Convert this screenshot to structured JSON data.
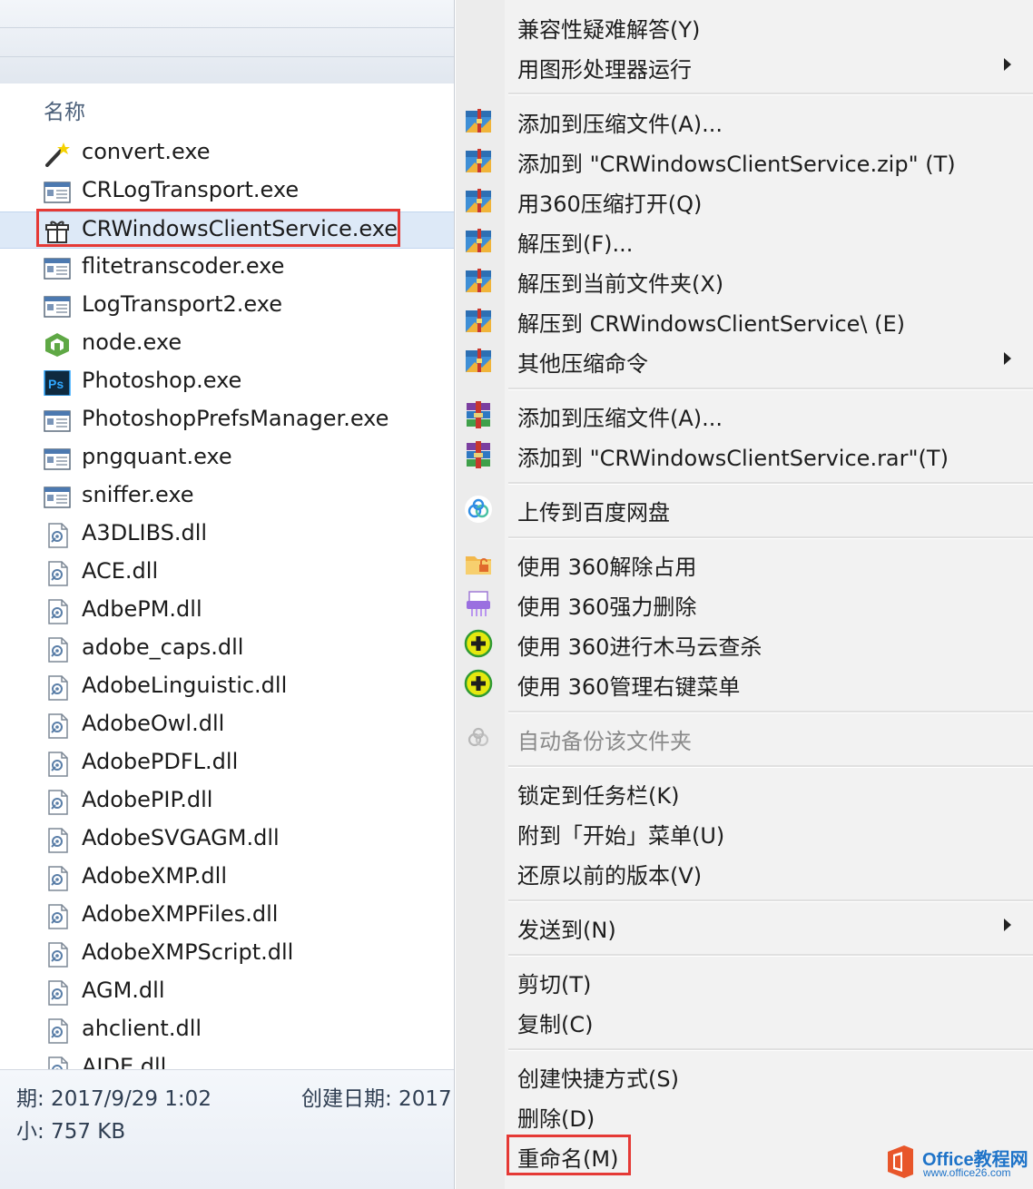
{
  "explorer": {
    "column_header": "名称",
    "files": [
      {
        "name": "convert.exe",
        "icon": "magic-wand-icon"
      },
      {
        "name": "CRLogTransport.exe",
        "icon": "exe-window-icon"
      },
      {
        "name": "CRWindowsClientService.exe",
        "icon": "gift-box-icon",
        "selected": true
      },
      {
        "name": "flitetranscoder.exe",
        "icon": "exe-window-icon"
      },
      {
        "name": "LogTransport2.exe",
        "icon": "exe-window-icon"
      },
      {
        "name": "node.exe",
        "icon": "node-icon"
      },
      {
        "name": "Photoshop.exe",
        "icon": "photoshop-icon"
      },
      {
        "name": "PhotoshopPrefsManager.exe",
        "icon": "exe-window-icon"
      },
      {
        "name": "pngquant.exe",
        "icon": "exe-window-icon"
      },
      {
        "name": "sniffer.exe",
        "icon": "exe-window-icon"
      },
      {
        "name": "A3DLIBS.dll",
        "icon": "dll-icon"
      },
      {
        "name": "ACE.dll",
        "icon": "dll-icon"
      },
      {
        "name": "AdbePM.dll",
        "icon": "dll-icon"
      },
      {
        "name": "adobe_caps.dll",
        "icon": "dll-icon"
      },
      {
        "name": "AdobeLinguistic.dll",
        "icon": "dll-icon"
      },
      {
        "name": "AdobeOwl.dll",
        "icon": "dll-icon"
      },
      {
        "name": "AdobePDFL.dll",
        "icon": "dll-icon"
      },
      {
        "name": "AdobePIP.dll",
        "icon": "dll-icon"
      },
      {
        "name": "AdobeSVGAGM.dll",
        "icon": "dll-icon"
      },
      {
        "name": "AdobeXMP.dll",
        "icon": "dll-icon"
      },
      {
        "name": "AdobeXMPFiles.dll",
        "icon": "dll-icon"
      },
      {
        "name": "AdobeXMPScript.dll",
        "icon": "dll-icon"
      },
      {
        "name": "AGM.dll",
        "icon": "dll-icon"
      },
      {
        "name": "ahclient.dll",
        "icon": "dll-icon"
      },
      {
        "name": "AIDE.dll",
        "icon": "dll-icon"
      }
    ],
    "status": {
      "modified": "期: 2017/9/29 1:02",
      "created": "创建日期: 2017",
      "size": "小: 757 KB"
    }
  },
  "context_menu": {
    "items": [
      {
        "label": "兼容性疑难解答(Y)",
        "icon": ""
      },
      {
        "label": "用图形处理器运行",
        "icon": "",
        "submenu": true
      },
      {
        "sep": true
      },
      {
        "label": "添加到压缩文件(A)...",
        "icon": "zip-archive-icon"
      },
      {
        "label": "添加到 \"CRWindowsClientService.zip\" (T)",
        "icon": "zip-archive-icon"
      },
      {
        "label": "用360压缩打开(Q)",
        "icon": "zip-archive-icon"
      },
      {
        "label": "解压到(F)...",
        "icon": "zip-archive-icon"
      },
      {
        "label": "解压到当前文件夹(X)",
        "icon": "zip-archive-icon"
      },
      {
        "label": "解压到 CRWindowsClientService\\ (E)",
        "icon": "zip-archive-icon"
      },
      {
        "label": "其他压缩命令",
        "icon": "zip-archive-icon",
        "submenu": true
      },
      {
        "sep": true
      },
      {
        "label": "添加到压缩文件(A)...",
        "icon": "winrar-icon"
      },
      {
        "label": "添加到 \"CRWindowsClientService.rar\"(T)",
        "icon": "winrar-icon"
      },
      {
        "sep": true
      },
      {
        "label": "上传到百度网盘",
        "icon": "baidu-cloud-icon"
      },
      {
        "sep": true
      },
      {
        "label": "使用 360解除占用",
        "icon": "unlock-folder-icon"
      },
      {
        "label": "使用 360强力删除",
        "icon": "shredder-icon"
      },
      {
        "label": "使用 360进行木马云查杀",
        "icon": "plus-circle-icon"
      },
      {
        "label": "使用 360管理右键菜单",
        "icon": "plus-circle-icon"
      },
      {
        "sep": true
      },
      {
        "label": "自动备份该文件夹",
        "icon": "baidu-cloud-gray-icon",
        "disabled": true
      },
      {
        "sep": true
      },
      {
        "label": "锁定到任务栏(K)",
        "icon": ""
      },
      {
        "label": "附到「开始」菜单(U)",
        "icon": ""
      },
      {
        "label": "还原以前的版本(V)",
        "icon": ""
      },
      {
        "sep": true
      },
      {
        "label": "发送到(N)",
        "icon": "",
        "submenu": true
      },
      {
        "sep": true
      },
      {
        "label": "剪切(T)",
        "icon": ""
      },
      {
        "label": "复制(C)",
        "icon": ""
      },
      {
        "sep": true
      },
      {
        "label": "创建快捷方式(S)",
        "icon": ""
      },
      {
        "label": "删除(D)",
        "icon": ""
      },
      {
        "label": "重命名(M)",
        "icon": "",
        "highlighted": true
      }
    ]
  },
  "watermark": {
    "title": "Office教程网",
    "url": "www.office26.com",
    "logo": "office-logo-icon"
  },
  "colors": {
    "highlight_red": "#e53935",
    "selection_blue": "#dde9f7",
    "watermark_blue": "#1e73c8"
  }
}
